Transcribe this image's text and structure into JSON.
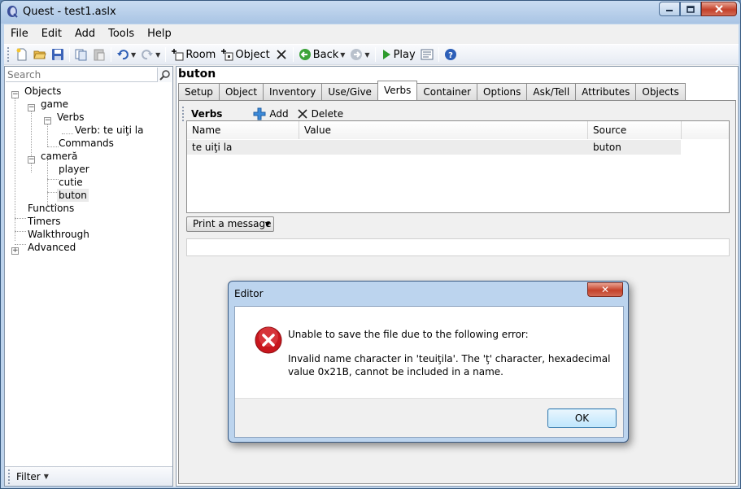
{
  "window": {
    "title": "Quest - test1.aslx"
  },
  "menu": [
    "File",
    "Edit",
    "Add",
    "Tools",
    "Help"
  ],
  "toolbar": {
    "room_label": "Room",
    "object_label": "Object",
    "back_label": "Back",
    "play_label": "Play"
  },
  "search": {
    "placeholder": "Search"
  },
  "tree": {
    "objects": "Objects",
    "game": "game",
    "verbs": "Verbs",
    "verb_item": "Verb: te uiţi la",
    "commands": "Commands",
    "camera": "cameră",
    "player": "player",
    "cutie": "cutie",
    "buton": "buton",
    "functions": "Functions",
    "timers": "Timers",
    "walkthrough": "Walkthrough",
    "advanced": "Advanced"
  },
  "filter": {
    "label": "Filter"
  },
  "editor": {
    "object_name": "buton",
    "tabs": [
      "Setup",
      "Object",
      "Inventory",
      "Use/Give",
      "Verbs",
      "Container",
      "Options",
      "Ask/Tell",
      "Attributes",
      "Objects"
    ],
    "active_tab": "Verbs",
    "verbs_title": "Verbs",
    "add_label": "Add",
    "delete_label": "Delete",
    "columns": [
      "Name",
      "Value",
      "Source"
    ],
    "rows": [
      {
        "name": "te uiţi la",
        "value": "",
        "source": "buton"
      }
    ],
    "dropdown_value": "Print a message"
  },
  "dialog": {
    "title": "Editor",
    "close_label": "✕",
    "message_line1": "Unable to save the file due to the following error:",
    "message_line2": "Invalid name character in 'teuiţila'. The 'ţ' character, hexadecimal value 0x21B, cannot be included in a name.",
    "ok_label": "OK"
  },
  "colors": {
    "accent": "#3c7fb1",
    "error_red": "#c8161d",
    "titlebar": "#bdd3ec"
  }
}
